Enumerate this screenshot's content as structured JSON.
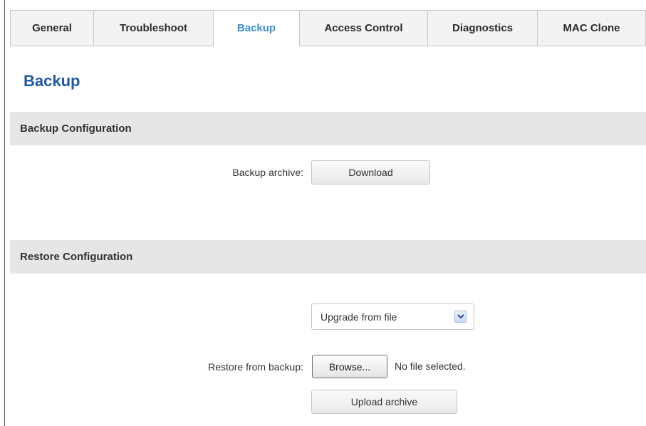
{
  "tabs": [
    {
      "label": "General",
      "active": false
    },
    {
      "label": "Troubleshoot",
      "active": false
    },
    {
      "label": "Backup",
      "active": true
    },
    {
      "label": "Access Control",
      "active": false
    },
    {
      "label": "Diagnostics",
      "active": false
    },
    {
      "label": "MAC Clone",
      "active": false
    }
  ],
  "page": {
    "title": "Backup"
  },
  "backup_section": {
    "header": "Backup Configuration",
    "archive_label": "Backup archive:",
    "download_button": "Download"
  },
  "restore_section": {
    "header": "Restore Configuration",
    "mode_select": {
      "selected": "Upgrade from file",
      "arrow_icon": "chevron-down-icon"
    },
    "restore_label": "Restore from backup:",
    "browse_button": "Browse...",
    "file_status": "No file selected.",
    "upload_button": "Upload archive"
  },
  "colors": {
    "active_tab": "#3a8fd6",
    "title": "#1f5aa6",
    "section_bar": "#e6e6e6"
  }
}
